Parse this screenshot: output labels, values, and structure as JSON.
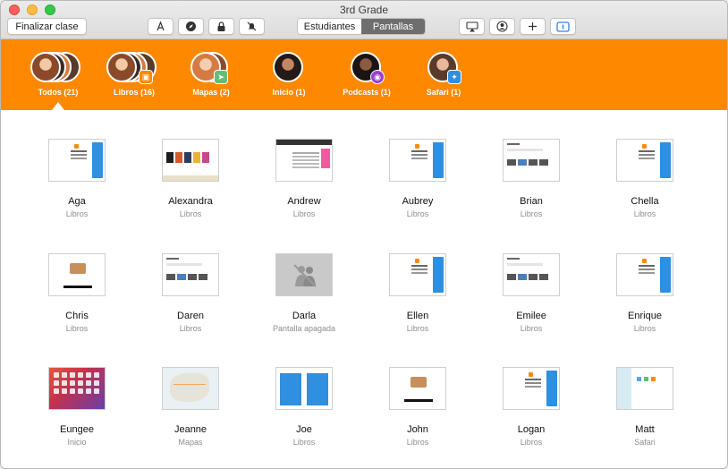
{
  "window": {
    "title": "3rd Grade"
  },
  "toolbar": {
    "end_class": "Finalizar clase",
    "segment": {
      "students": "Estudiantes",
      "screens": "Pantallas",
      "selected": "Pantallas"
    }
  },
  "groups": [
    {
      "label": "Todos (21)",
      "selected": true
    },
    {
      "label": "Libros (16)"
    },
    {
      "label": "Mapas (2)"
    },
    {
      "label": "Inicio (1)"
    },
    {
      "label": "Podcasts (1)"
    },
    {
      "label": "Safari (1)"
    }
  ],
  "students": [
    {
      "name": "Aga",
      "app": "Libros"
    },
    {
      "name": "Alexandra",
      "app": "Libros"
    },
    {
      "name": "Andrew",
      "app": "Libros"
    },
    {
      "name": "Aubrey",
      "app": "Libros"
    },
    {
      "name": "Brian",
      "app": "Libros"
    },
    {
      "name": "Chella",
      "app": "Libros"
    },
    {
      "name": "Chris",
      "app": "Libros"
    },
    {
      "name": "Daren",
      "app": "Libros"
    },
    {
      "name": "Darla",
      "app": "Pantalla apagada"
    },
    {
      "name": "Ellen",
      "app": "Libros"
    },
    {
      "name": "Emilee",
      "app": "Libros"
    },
    {
      "name": "Enrique",
      "app": "Libros"
    },
    {
      "name": "Eungee",
      "app": "Inicio"
    },
    {
      "name": "Jeanne",
      "app": "Mapas"
    },
    {
      "name": "Joe",
      "app": "Libros"
    },
    {
      "name": "John",
      "app": "Libros"
    },
    {
      "name": "Logan",
      "app": "Libros"
    },
    {
      "name": "Matt",
      "app": "Safari"
    }
  ],
  "colors": {
    "accent": "#fe8800"
  }
}
